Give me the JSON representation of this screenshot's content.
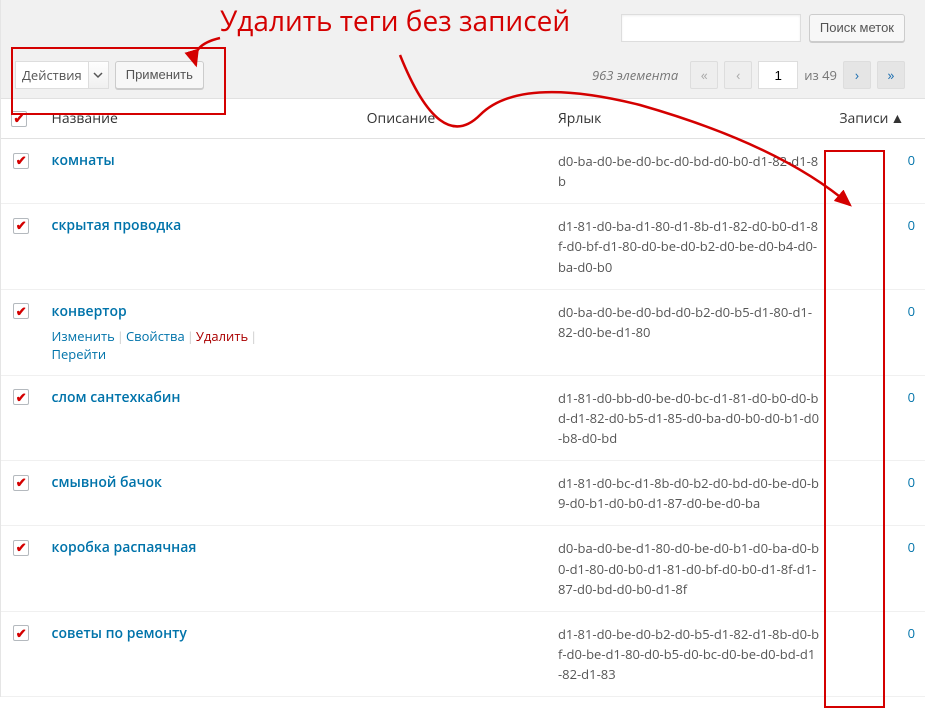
{
  "annotation": {
    "title": "Удалить теги без записей"
  },
  "search": {
    "value": "",
    "button": "Поиск меток"
  },
  "bulk": {
    "select_label": "Действия",
    "apply": "Применить"
  },
  "pagination": {
    "count_text": "963 элемента",
    "current": "1",
    "of_text": "из 49"
  },
  "columns": {
    "name": "Название",
    "desc": "Описание",
    "slug": "Ярлык",
    "posts": "Записи"
  },
  "sort_indicator": "▲",
  "row_actions": {
    "edit": "Изменить",
    "quick": "Свойства",
    "delete": "Удалить",
    "view": "Перейти"
  },
  "rows": [
    {
      "checked": true,
      "name": "комнаты",
      "slug": "d0-ba-d0-be-d0-bc-d0-bd-d0-b0-d1-82-d1-8b",
      "posts": "0",
      "actions": false
    },
    {
      "checked": true,
      "name": "скрытая проводка",
      "slug": "d1-81-d0-ba-d1-80-d1-8b-d1-82-d0-b0-d1-8f-d0-bf-d1-80-d0-be-d0-b2-d0-be-d0-b4-d0-ba-d0-b0",
      "posts": "0",
      "actions": false
    },
    {
      "checked": true,
      "name": "конвертор",
      "slug": "d0-ba-d0-be-d0-bd-d0-b2-d0-b5-d1-80-d1-82-d0-be-d1-80",
      "posts": "0",
      "actions": true
    },
    {
      "checked": true,
      "name": "слом сантехкабин",
      "slug": "d1-81-d0-bb-d0-be-d0-bc-d1-81-d0-b0-d0-bd-d1-82-d0-b5-d1-85-d0-ba-d0-b0-d0-b1-d0-b8-d0-bd",
      "posts": "0",
      "actions": false
    },
    {
      "checked": true,
      "name": "смывной бачок",
      "slug": "d1-81-d0-bc-d1-8b-d0-b2-d0-bd-d0-be-d0-b9-d0-b1-d0-b0-d1-87-d0-be-d0-ba",
      "posts": "0",
      "actions": false
    },
    {
      "checked": true,
      "name": "коробка распаячная",
      "slug": "d0-ba-d0-be-d1-80-d0-be-d0-b1-d0-ba-d0-b0-d1-80-d0-b0-d1-81-d0-bf-d0-b0-d1-8f-d1-87-d0-bd-d0-b0-d1-8f",
      "posts": "0",
      "actions": false
    },
    {
      "checked": true,
      "name": "советы по ремонту",
      "slug": "d1-81-d0-be-d0-b2-d0-b5-d1-82-d1-8b-d0-bf-d0-be-d1-80-d0-b5-d0-bc-d0-be-d0-bd-d1-82-d1-83",
      "posts": "0",
      "actions": false
    }
  ]
}
